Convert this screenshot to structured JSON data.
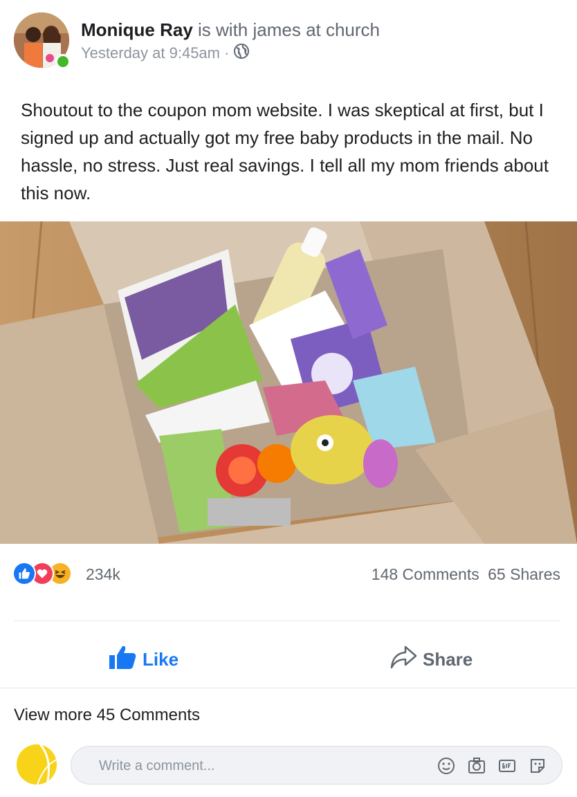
{
  "post": {
    "author": "Monique Ray",
    "with_text": "is with james at church",
    "timestamp": "Yesterday at 9:45am",
    "separator": "·",
    "privacy_icon": "globe-icon",
    "body": "Shoutout to the coupon mom website. I was skeptical at first, but I signed up and actually got my free baby products in the mail. No hassle, no stress. Just real savings. I tell all my mom friends about this now."
  },
  "reactions": {
    "icons": [
      "like-icon",
      "love-icon",
      "haha-icon"
    ],
    "count": "234k",
    "comments": "148 Comments",
    "shares": "65 Shares"
  },
  "actions": {
    "like_label": "Like",
    "share_label": "Share"
  },
  "comments": {
    "view_more": "View more 45 Comments",
    "placeholder": "Write a comment...",
    "input_icons": [
      "emoji-icon",
      "camera-icon",
      "gif-icon",
      "sticker-icon"
    ]
  },
  "colors": {
    "brand_blue": "#1877f2",
    "online_green": "#42b72a",
    "love_red": "#f33e58",
    "haha_yellow": "#f7b125"
  }
}
